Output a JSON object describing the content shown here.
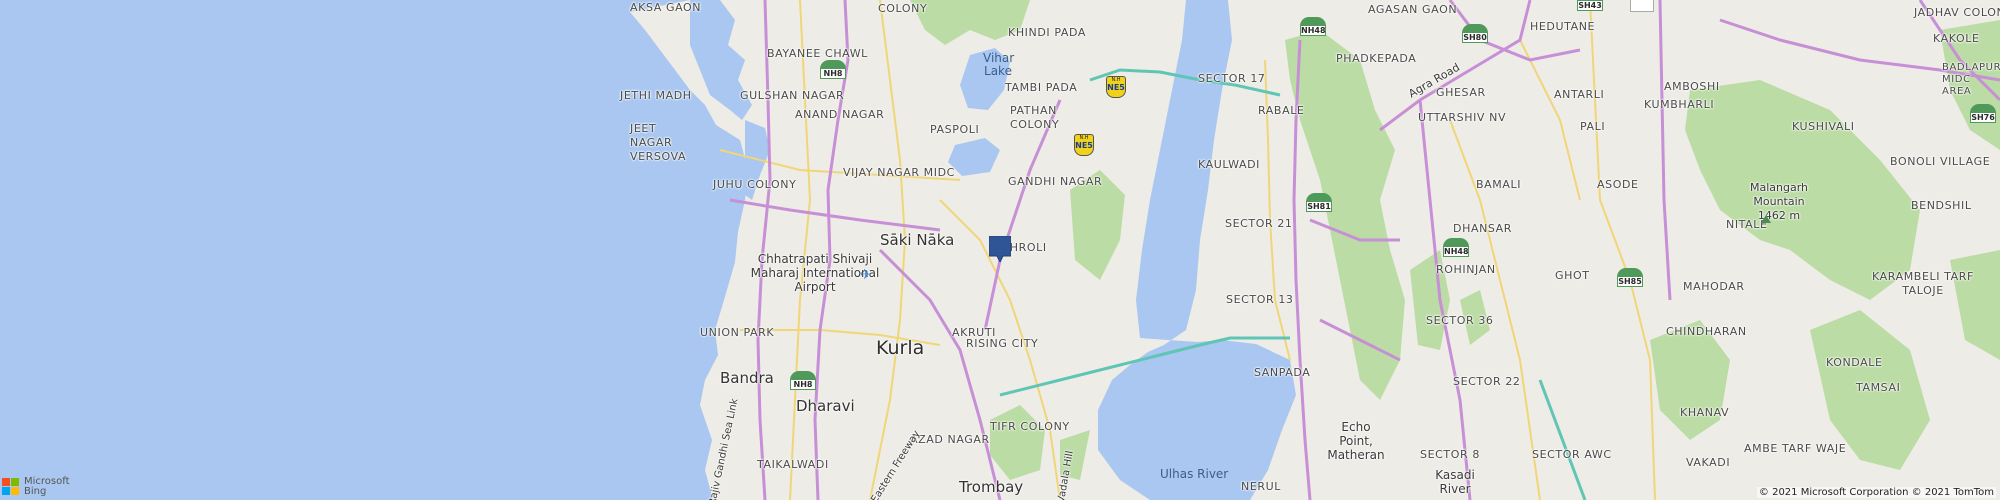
{
  "map": {
    "colors": {
      "water": "#a9c7f0",
      "land": "#eeece6",
      "hills": "#bcdca5",
      "major_road": "#c78fd6",
      "minor_road": "#f0d677",
      "expressway": "#5fc5b5",
      "pin": "#2f5597"
    },
    "areas": [
      "AKSA GAON",
      "COLONY",
      "KHINDI PADA",
      "AGASAN GAON",
      "HEDUTANE",
      "JADHAV COLONY",
      "BAYANEE CHAWL",
      "PHADKEPADA",
      "KAKOLE",
      "JETHI MADH",
      "GULSHAN NAGAR",
      "TAMBI PADA",
      "SECTOR 17",
      "GHESAR",
      "ANTARLI",
      "AMBOSHI",
      "BADLAPUR MIDC AREA",
      "ANAND NAGAR",
      "PATHAN COLONY",
      "RABALE",
      "UTTARSHIV NV",
      "JEET NAGAR VERSOVA",
      "PASPOLI",
      "PALI",
      "KUMBHARLI",
      "KUSHIVALI",
      "KAULWADI",
      "VIJAY NAGAR MIDC",
      "BONOLI VILLAGE",
      "GANDHI NAGAR",
      "BAMALI",
      "ASODE",
      "JUHU COLONY",
      "BENDSHIL",
      "NITALE",
      "DHANSAR",
      "VIKHROLI",
      "SECTOR 21",
      "ROHINJAN",
      "GHOT",
      "MAHODAR",
      "KARAMBELI TARF TALOJE",
      "AKRUTI",
      "RISING CITY",
      "SECTOR 13",
      "SECTOR 36",
      "CHINDHARAN",
      "UNION PARK",
      "SECTOR 22",
      "KONDALE",
      "SANPADA",
      "TAMSAI",
      "KHANAV",
      "TIFR COLONY",
      "TAIKALWADI",
      "AZAD NAGAR",
      "SECTOR 8",
      "SECTOR AWC",
      "AMBE TARF WAJE",
      "VAKADI",
      "NERUL"
    ],
    "places": [
      "Sāki Nāka",
      "Kurla",
      "Bandra",
      "Dharavi",
      "Trombay"
    ],
    "pois": {
      "airport": "Chhatrapati Shivaji Maharaj International Airport",
      "mountain": "Malangarh Mountain 1462 m",
      "echo_point": "Echo Point, Matheran",
      "kasadi": "Kasadi River"
    },
    "water_labels": [
      "Vihar Lake",
      "Ulhas River"
    ],
    "roads": [
      "Agra Road",
      "Rajiv Gandhi Sea Link",
      "Eastern Freeway",
      "Vadala Hill"
    ],
    "shields": [
      "NH8",
      "NH8",
      "NH48",
      "SH80",
      "SH43",
      "SH76",
      "SH81",
      "NH48",
      "SH85"
    ],
    "ne": {
      "small": "N.H",
      "number": "NE5"
    },
    "icons": {
      "pin": "location-pin-icon",
      "airport": "airport-icon",
      "peak": "mountain-peak-icon",
      "logo": "microsoft-logo-icon"
    }
  },
  "branding": {
    "line1": "Microsoft",
    "line2": "Bing"
  },
  "copyright": "© 2021 Microsoft Corporation © 2021 TomTom"
}
